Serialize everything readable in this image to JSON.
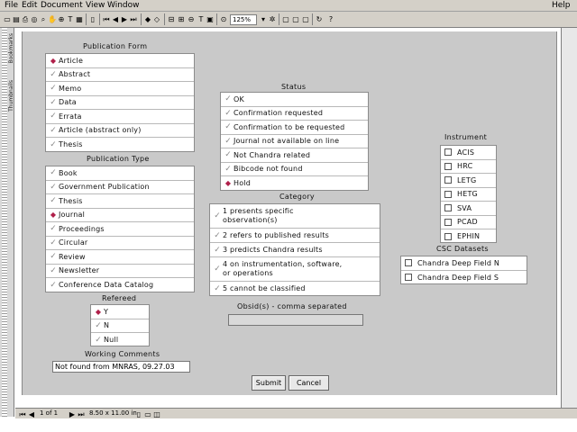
{
  "menubar": {
    "items": [
      "File",
      "Edit",
      "Document",
      "View",
      "Window"
    ],
    "help": "Help"
  },
  "toolbar": {
    "zoom": "125%"
  },
  "sidebar": {
    "tabs": [
      "Thumbnails",
      "Bookmarks"
    ]
  },
  "publication_form": {
    "title": "Publication Form",
    "items": [
      {
        "label": "Article",
        "selected": true
      },
      {
        "label": "Abstract",
        "selected": false
      },
      {
        "label": "Memo",
        "selected": false
      },
      {
        "label": "Data",
        "selected": false
      },
      {
        "label": "Errata",
        "selected": false
      },
      {
        "label": "Article (abstract only)",
        "selected": false
      },
      {
        "label": "Thesis",
        "selected": false
      }
    ]
  },
  "publication_type": {
    "title": "Publication Type",
    "items": [
      {
        "label": "Book",
        "selected": false
      },
      {
        "label": "Government Publication",
        "selected": false
      },
      {
        "label": "Thesis",
        "selected": false
      },
      {
        "label": "Journal",
        "selected": true
      },
      {
        "label": "Proceedings",
        "selected": false
      },
      {
        "label": "Circular",
        "selected": false
      },
      {
        "label": "Review",
        "selected": false
      },
      {
        "label": "Newsletter",
        "selected": false
      },
      {
        "label": "Conference Data Catalog",
        "selected": false
      }
    ]
  },
  "refereed": {
    "title": "Refereed",
    "items": [
      {
        "label": "Y",
        "selected": true
      },
      {
        "label": "N",
        "selected": false
      },
      {
        "label": "Null",
        "selected": false
      }
    ]
  },
  "working_comments": {
    "title": "Working Comments",
    "value": "Not found from MNRAS, 09.27.03"
  },
  "status": {
    "title": "Status",
    "items": [
      {
        "label": "OK",
        "selected": false
      },
      {
        "label": "Confirmation requested",
        "selected": false
      },
      {
        "label": "Confirmation to be requested",
        "selected": false
      },
      {
        "label": "Journal not available on line",
        "selected": false
      },
      {
        "label": "Not Chandra related",
        "selected": false
      },
      {
        "label": "Bibcode not found",
        "selected": false
      },
      {
        "label": "Hold",
        "selected": true
      }
    ]
  },
  "category": {
    "title": "Category",
    "items": [
      {
        "label": "1 presents specific observation(s)"
      },
      {
        "label": "2 refers to published results"
      },
      {
        "label": "3 predicts Chandra results"
      },
      {
        "label": "4 on instrumentation, software, or operations"
      },
      {
        "label": "5 cannot be classified"
      }
    ]
  },
  "obsid": {
    "title": "Obsid(s) - comma separated",
    "value": ""
  },
  "instrument": {
    "title": "Instrument",
    "items": [
      "ACIS",
      "HRC",
      "LETG",
      "HETG",
      "SVA",
      "PCAD",
      "EPHIN"
    ]
  },
  "csc_datasets": {
    "title": "CSC Datasets",
    "items": [
      "Chandra Deep Field N",
      "Chandra Deep Field S"
    ]
  },
  "buttons": {
    "submit": "Submit",
    "cancel": "Cancel"
  },
  "statusbar": {
    "page": "1 of 1",
    "size": "8.50 x 11.00 in"
  }
}
